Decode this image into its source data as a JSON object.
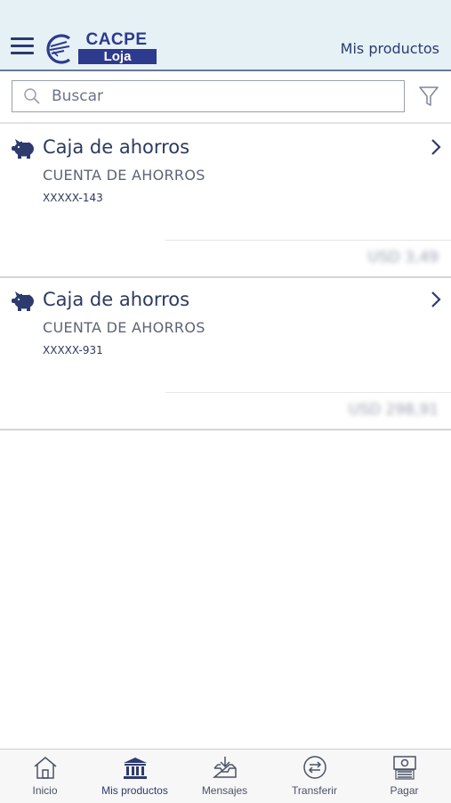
{
  "header": {
    "title": "Mis productos",
    "menu_icon": "hamburger-menu-icon",
    "logo": {
      "name": "CACPE",
      "city": "Loja"
    }
  },
  "search": {
    "placeholder": "Buscar",
    "value": ""
  },
  "filter_icon": "filter-funnel-icon",
  "products": [
    {
      "icon": "piggy-bank-icon",
      "title": "Caja de ahorros",
      "type": "CUENTA DE AHORROS",
      "number": "XXXXX-143",
      "balance": "USD 3,49"
    },
    {
      "icon": "piggy-bank-icon",
      "title": "Caja de ahorros",
      "type": "CUENTA DE AHORROS",
      "number": "XXXXX-931",
      "balance": "USD 298,91"
    }
  ],
  "tabs": [
    {
      "icon": "home-icon",
      "label": "Inicio"
    },
    {
      "icon": "bank-icon",
      "label": "Mis productos",
      "active": true
    },
    {
      "icon": "inbox-download-icon",
      "label": "Mensajes"
    },
    {
      "icon": "transfer-arrows-icon",
      "label": "Transferir"
    },
    {
      "icon": "bill-payment-icon",
      "label": "Pagar"
    }
  ],
  "colors": {
    "primary": "#2d3a6e",
    "header_bg": "#e6f1f6",
    "logo_blue": "#2d3a8e"
  }
}
